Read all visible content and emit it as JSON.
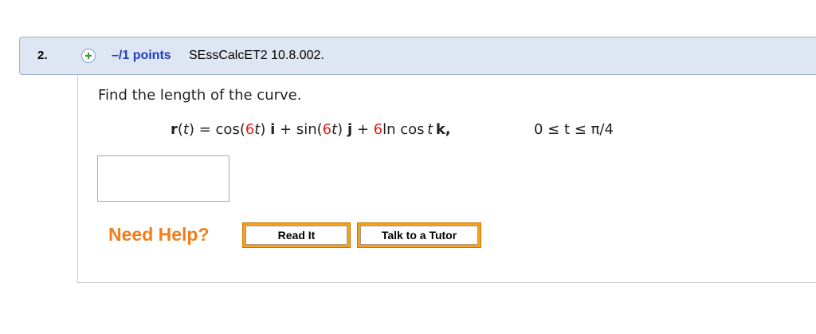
{
  "header": {
    "question_number": "2.",
    "points": "–/1 points",
    "problem_code": "SEssCalcET2 10.8.002."
  },
  "question": {
    "prompt": "Find the length of the curve.",
    "equation": {
      "r": "r",
      "t1": "(",
      "t_var": "t",
      "t2": ") = cos(",
      "coef1": "6",
      "t_var2": "t",
      "t3": ")",
      "i": "i",
      "t4": "+ sin(",
      "coef2": "6",
      "t_var3": "t",
      "t5": ")",
      "j": "j",
      "t6": "+",
      "coef3": "6",
      "t7": "ln cos",
      "t_var4": "t",
      "k": "k,"
    },
    "range": {
      "a": "0 ≤ ",
      "t": "t",
      "b": " ≤ π/4"
    }
  },
  "answer": {
    "value": ""
  },
  "help": {
    "label": "Need Help?",
    "read_it": "Read It",
    "talk_to_tutor": "Talk to a Tutor"
  },
  "colors": {
    "header_bg": "#dfe6f3",
    "points_text": "#1a3fbd",
    "coefficient_red": "#e0201c",
    "help_orange": "#f07d1a",
    "button_orange": "#f7a01c"
  },
  "icons": {
    "expand": "plus-circle-icon"
  }
}
